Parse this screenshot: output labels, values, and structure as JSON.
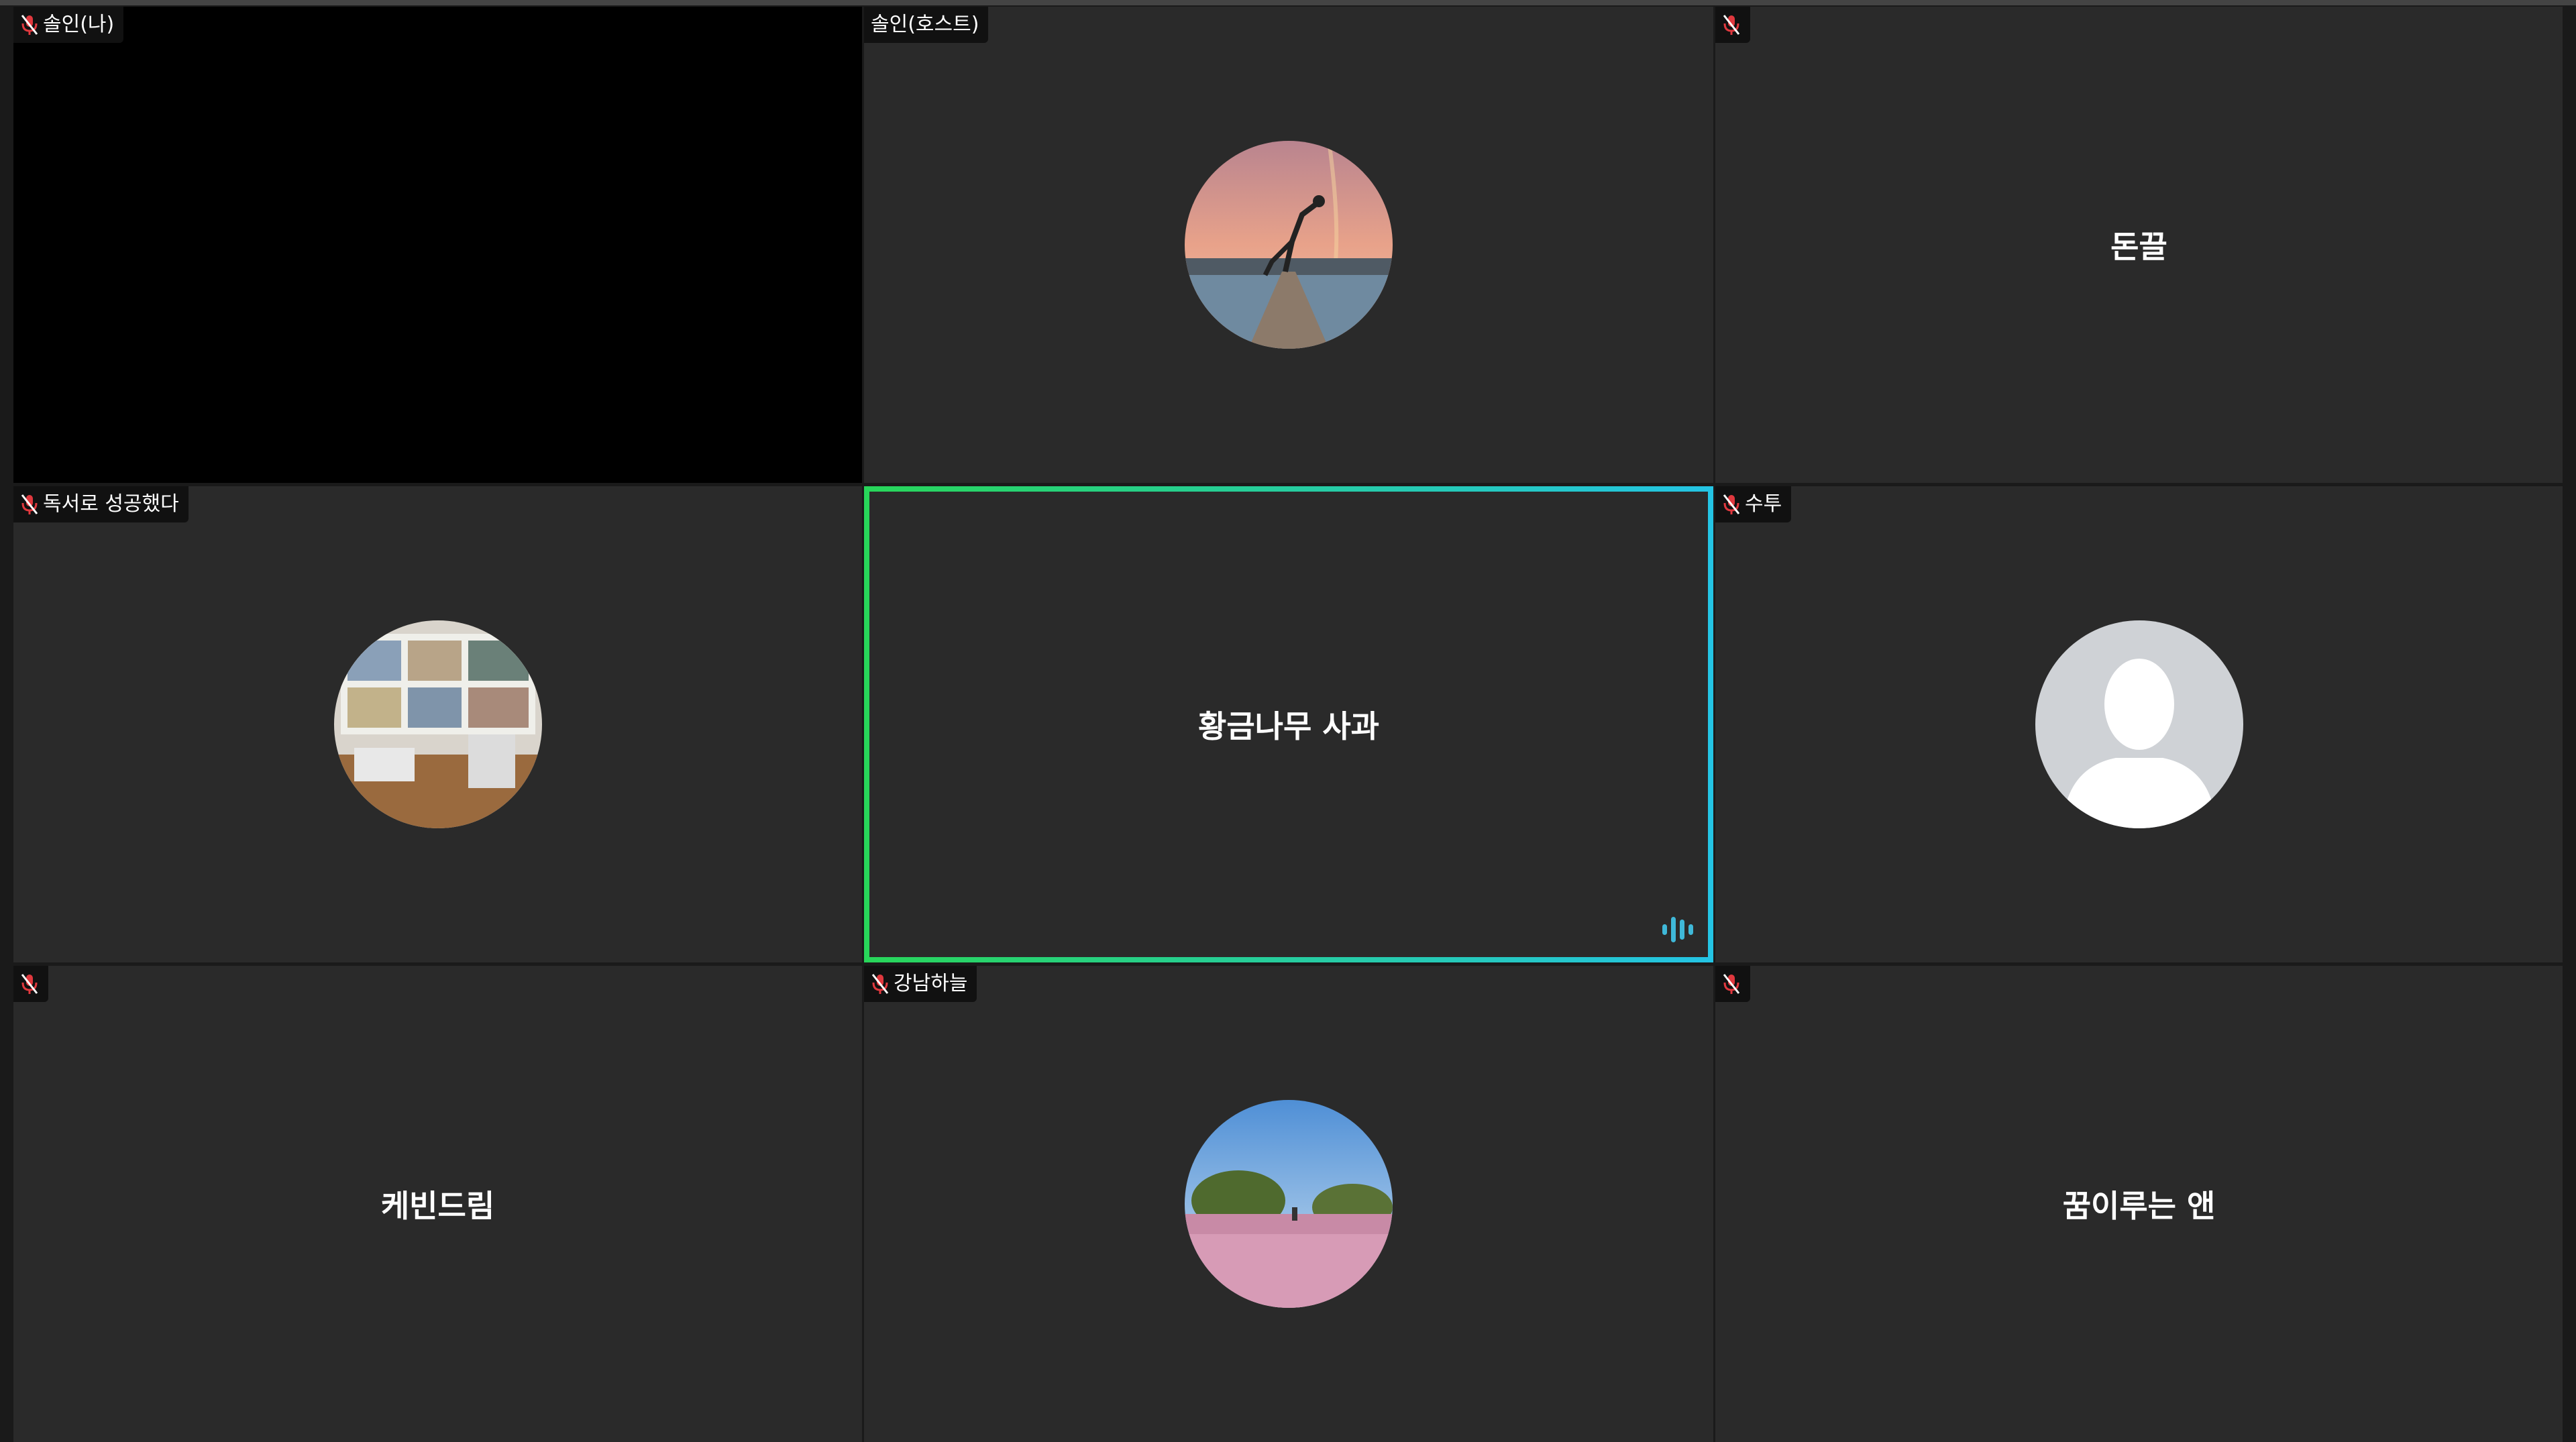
{
  "participants": [
    {
      "name": "솔인(나)",
      "mic_muted": true,
      "display": "black"
    },
    {
      "name": "솔인(호스트)",
      "mic_muted": false,
      "display": "avatar-photo",
      "avatar": "dancer-sunset-photo"
    },
    {
      "name": "돈끌",
      "mic_muted": true,
      "display": "name"
    },
    {
      "name": "독서로 성공했다",
      "mic_muted": true,
      "display": "avatar-photo",
      "avatar": "bookshelf-desk-photo"
    },
    {
      "name": "황금나무 사과",
      "mic_muted": false,
      "display": "name",
      "speaking": true
    },
    {
      "name": "수투",
      "mic_muted": true,
      "display": "avatar-photo",
      "avatar": "default-person-silhouette"
    },
    {
      "name": "케빈드림",
      "mic_muted": true,
      "display": "name"
    },
    {
      "name": "강남하늘",
      "mic_muted": true,
      "display": "avatar-photo",
      "avatar": "pink-field-photo"
    },
    {
      "name": "꿈이루는 앤",
      "mic_muted": true,
      "display": "name"
    }
  ],
  "colors": {
    "tile_bg": "#2a2a2a",
    "speaking_border_start": "#28d65a",
    "speaking_border_end": "#24c4e4",
    "muted_mic": "#e0383e",
    "audio_indicator": "#3fb8d8"
  }
}
